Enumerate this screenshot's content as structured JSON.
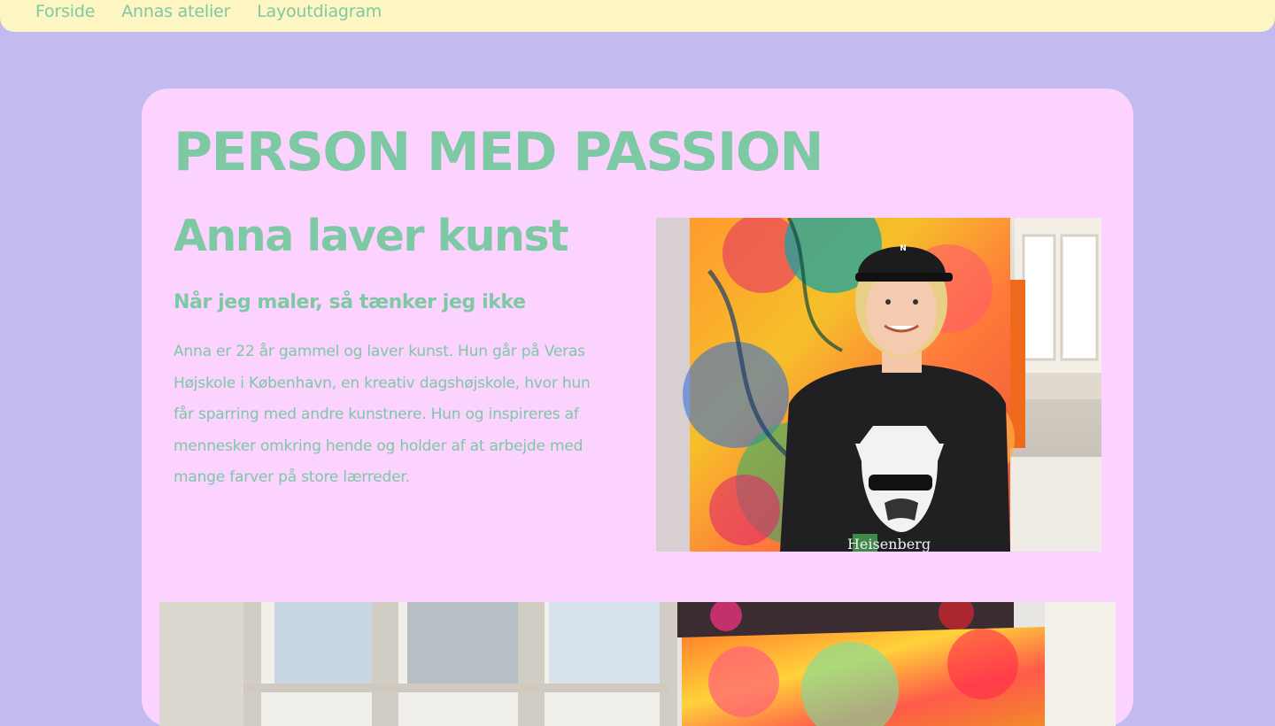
{
  "nav": {
    "items": [
      {
        "label": "Forside"
      },
      {
        "label": "Annas atelier"
      },
      {
        "label": "Layoutdiagram"
      }
    ]
  },
  "hero": {
    "title": "PERSON MED PASSION",
    "heading": "Anna laver kunst",
    "subheading": "Når jeg maler, så tænker jeg ikke",
    "body": "Anna er 22 år gammel og laver kunst. Hun går på Veras Højskole i København, en kreativ dagshøjskole, hvor hun får sparring med andre kunstnere. Hun og inspireres af mennesker omkring hende og holder af at arbejde med mange farver på store lærreder.",
    "photo_shirt_text": "Heisenberg",
    "photo_cap_letter": "N"
  },
  "colors": {
    "page_bg": "#c3bbef",
    "nav_bg": "#fdf6c3",
    "card_bg": "#fcd2fe",
    "accent_text": "#7cc9a4"
  }
}
